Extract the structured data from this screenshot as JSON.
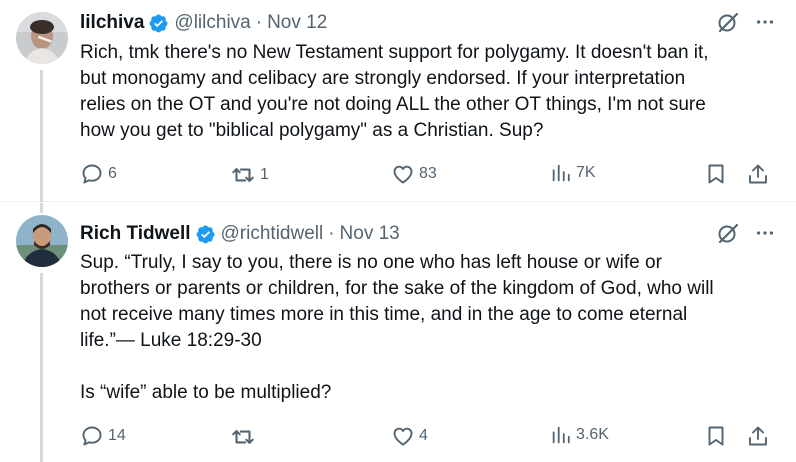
{
  "tweets": [
    {
      "name": "lilchiva",
      "handle": "@lilchiva",
      "separator": "·",
      "date": "Nov 12",
      "text": "Rich, tmk there's no New Testament support for polygamy. It doesn't ban it,\nbut monogamy and celibacy are strongly endorsed.  If your interpretation\nrelies on the OT and you're not doing ALL the other OT things, I'm not sure\nhow you get to \"biblical polygamy\" as a Christian. Sup?",
      "replies": "6",
      "reposts": "1",
      "likes": "83",
      "views": "7K"
    },
    {
      "name": "Rich Tidwell",
      "handle": "@richtidwell",
      "separator": "·",
      "date": "Nov 13",
      "text": "Sup. “Truly, I say to you, there is no one who has left house or wife or\nbrothers or parents or children, for the sake of the kingdom of God, who will\nnot receive many times more in this time, and in the age to come eternal\nlife.”— Luke 18:29-30\n\nIs “wife” able to be multiplied?",
      "replies": "14",
      "reposts": "",
      "likes": "4",
      "views": "3.6K"
    }
  ],
  "icons": {
    "verified": "verified-badge-icon",
    "grok": "grok-icon",
    "more": "more-icon",
    "reply": "reply-icon",
    "repost": "repost-icon",
    "like": "like-icon",
    "views": "views-icon",
    "bookmark": "bookmark-icon",
    "share": "share-icon"
  },
  "colors": {
    "verified": "#1d9bf0",
    "secondary_text": "#536471",
    "primary_text": "#0f1419",
    "thread_line": "#cfd9de"
  }
}
